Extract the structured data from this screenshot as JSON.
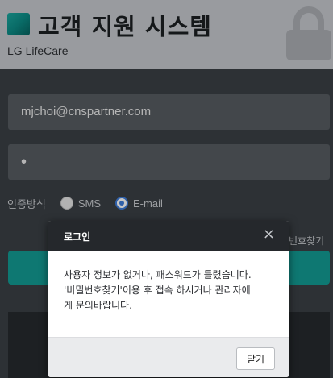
{
  "header": {
    "title": "고객 지원 시스템",
    "brand": "LG LifeCare",
    "logo_color": "#139a93"
  },
  "login_form": {
    "email_value": "mjchoi@cnspartner.com",
    "password_value": "•",
    "auth_label": "인증방식",
    "auth_options": [
      {
        "label": "SMS",
        "selected": false
      },
      {
        "label": "E-mail",
        "selected": true
      }
    ],
    "find_password_partial": "번호찾기",
    "login_button_color": "#139a93"
  },
  "dialog": {
    "title": "로그인",
    "close_symbol": "×",
    "message_line1": "사용자 정보가 없거나, 패스워드가 틀렸습니다.",
    "message_line2": "'비밀번호찾기'이용 후 접속 하시거나 관리자에",
    "message_line3": "게 문의바랍니다.",
    "ok_label": "닫기"
  }
}
